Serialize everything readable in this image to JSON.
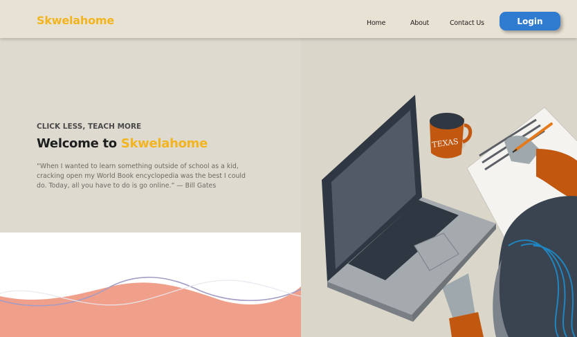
{
  "header": {
    "brand": "Skwelahome",
    "nav": {
      "home": "Home",
      "about": "About",
      "contact": "Contact Us"
    },
    "login_label": "Login"
  },
  "hero": {
    "eyebrow": "CLICK LESS, TEACH MORE",
    "headline_prefix": "Welcome to",
    "headline_brand": "Skwelahome",
    "quote": "“When I wanted to learn something outside of school as a kid, cracking open my World Book encyclopedia was the best I could do. Today, all you have to do is go online.” — Bill Gates"
  },
  "illustration": {
    "mug_text": "TEXAS"
  },
  "colors": {
    "brand": "#f2b41f",
    "login_button": "#2f7bd0",
    "header_bg": "#e8e2d4",
    "hero_bg": "#dedad0",
    "wave": "#f0a08a"
  }
}
